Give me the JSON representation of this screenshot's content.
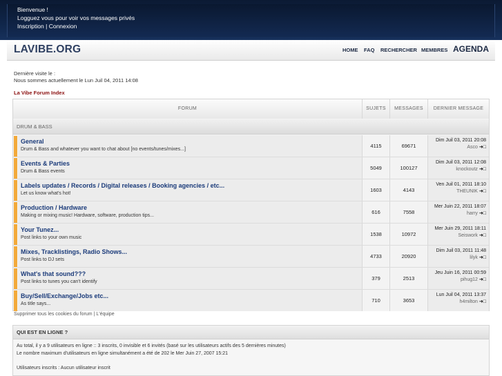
{
  "top": {
    "welcome": "Bienvenue !",
    "login_msg": "Logguez vous pour voir vos messages privés",
    "register": "Inscription",
    "separator": "|",
    "login": "Connexion"
  },
  "nav": {
    "logo": "LAVIBE.ORG",
    "home": "HOME",
    "faq": "FAQ",
    "search": "RECHERCHER",
    "members": "MEMBRES",
    "agenda": "AGENDA"
  },
  "info": {
    "last_visit": "Dernière visite le :",
    "current_time": "Nous sommes actuellement le Lun Juil 04, 2011 14:08"
  },
  "breadcrumb": "La Vibe Forum Index",
  "table": {
    "headers": [
      "FORUM",
      "SUJETS",
      "MESSAGES",
      "DERNIER MESSAGE"
    ],
    "category": "DRUM & BASS",
    "rows": [
      {
        "title": "General",
        "desc": "Drum & Bass and whatever you want to chat about [no events/tunes/mixes...]",
        "topics": "4115",
        "posts": "69671",
        "date": "Dim Juil 03, 2011 20:08",
        "user": "Asco"
      },
      {
        "title": "Events & Parties",
        "desc": "Drum & Bass events",
        "topics": "5049",
        "posts": "100127",
        "date": "Dim Juil 03, 2011 12:08",
        "user": "knockoutz"
      },
      {
        "title": "Labels updates / Records / Digital releases / Booking agencies / etc...",
        "desc": "Let us know what's hot!",
        "topics": "1603",
        "posts": "4143",
        "date": "Ven Juil 01, 2011 18:10",
        "user": "THEUNIK"
      },
      {
        "title": "Production / Hardware",
        "desc": "Making or mixing music! Hardware, software, production tips...",
        "topics": "616",
        "posts": "7558",
        "date": "Mer Juin 22, 2011 18:07",
        "user": "harry"
      },
      {
        "title": "Your Tunez...",
        "desc": "Post links to your own music",
        "topics": "1538",
        "posts": "10972",
        "date": "Mer Juin 29, 2011 18:11",
        "user": "Seiswork"
      },
      {
        "title": "Mixes, Tracklistings, Radio Shows...",
        "desc": "Post links to DJ sets",
        "topics": "4733",
        "posts": "20920",
        "date": "Dim Juil 03, 2011 11:48",
        "user": "lilyk"
      },
      {
        "title": "What's that sound???",
        "desc": "Post links to tunes you can't identify",
        "topics": "379",
        "posts": "2513",
        "date": "Jeu Juin 16, 2011 00:59",
        "user": "pihug12"
      },
      {
        "title": "Buy/Sell/Exchange/Jobs etc...",
        "desc": "As title says...",
        "topics": "710",
        "posts": "3653",
        "date": "Lun Juil 04, 2011 13:37",
        "user": "h4milton"
      }
    ]
  },
  "footer_links": {
    "cookies": "Supprimer tous les cookies du forum",
    "separator": "|",
    "team": "L'équipe"
  },
  "online": {
    "title": "QUI EST EN LIGNE ?",
    "line1": "Au total, il y a 9 utilisateurs en ligne :: 3 inscrits, 0 invisible et 6 invités (basé sur les utilisateurs actifs des 5 dernières minutes)",
    "line2": "Le nombre maximum d'utilisateurs en ligne simultanément a été de 202 le Mer Juin 27, 2007 15:21",
    "line3": "Utilisateurs inscrits : Aucun utilisateur inscrit"
  },
  "colors": {
    "topbar": "#10264a",
    "accent_bar": "#f2a93a",
    "forum_link": "#1b3b7a",
    "breadcrumb": "#8b1010"
  },
  "icons": {
    "last_post": "arrow-right-icon"
  }
}
